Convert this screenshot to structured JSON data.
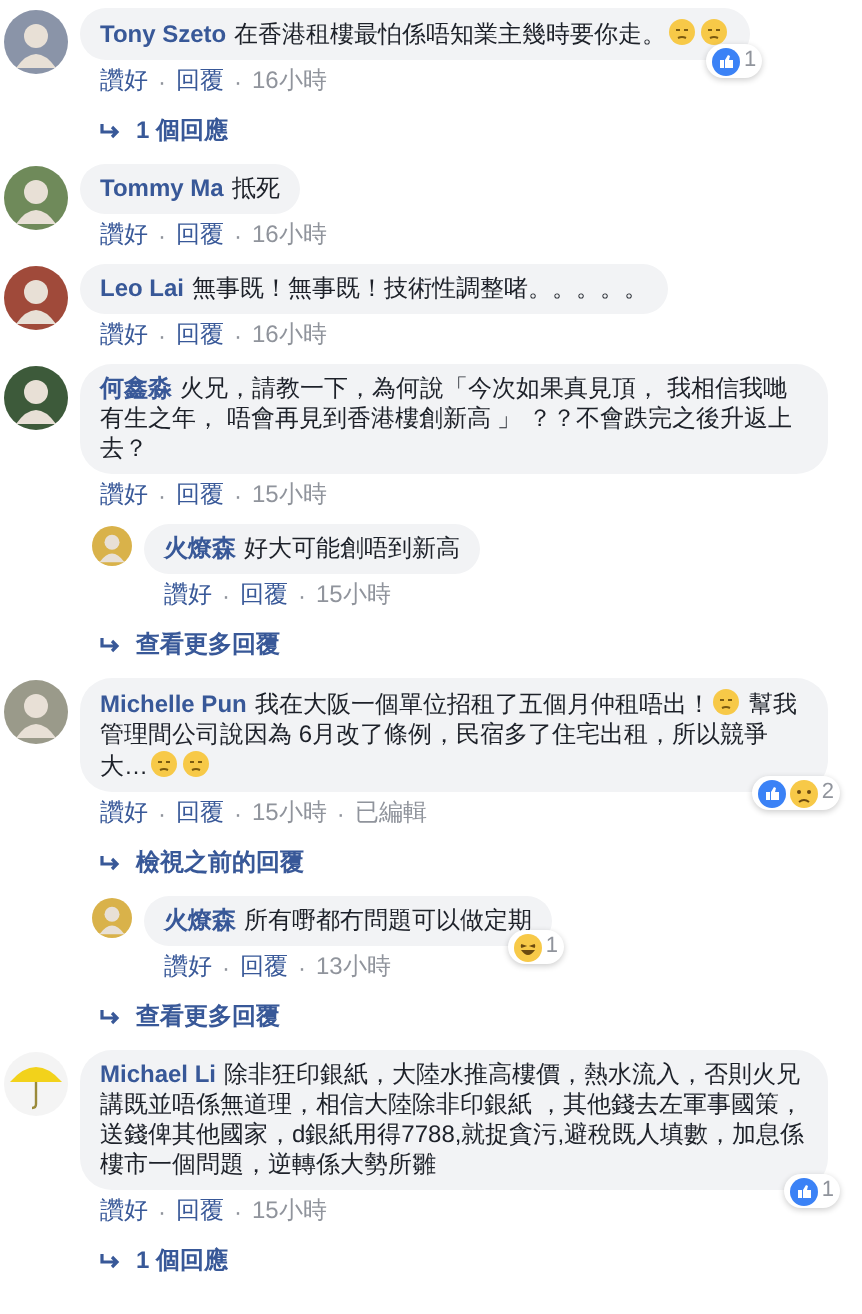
{
  "items": [
    {
      "kind": "comment",
      "avatar": {
        "kind": "person",
        "color": "#8a94a8"
      },
      "author": "Tony Szeto",
      "parts": [
        {
          "kind": "text",
          "text": "在香港租樓最怕係唔知業主幾時要你走。"
        },
        {
          "kind": "emoji"
        },
        {
          "kind": "emoji"
        }
      ],
      "meta": [
        {
          "kind": "link",
          "text": "讚好"
        },
        {
          "kind": "sep",
          "text": "·"
        },
        {
          "kind": "link",
          "text": "回覆"
        },
        {
          "kind": "sep",
          "text": "·"
        },
        {
          "kind": "time",
          "text": "16小時"
        }
      ],
      "reactions": {
        "icons": [
          {
            "kind": "like"
          }
        ],
        "count": "1"
      }
    },
    {
      "kind": "more",
      "text": "1 個回應"
    },
    {
      "kind": "comment",
      "avatar": {
        "kind": "person",
        "color": "#6f8a5a"
      },
      "author": "Tommy Ma",
      "parts": [
        {
          "kind": "text",
          "text": "抵死"
        }
      ],
      "meta": [
        {
          "kind": "link",
          "text": "讚好"
        },
        {
          "kind": "sep",
          "text": "·"
        },
        {
          "kind": "link",
          "text": "回覆"
        },
        {
          "kind": "sep",
          "text": "·"
        },
        {
          "kind": "time",
          "text": "16小時"
        }
      ]
    },
    {
      "kind": "comment",
      "avatar": {
        "kind": "person",
        "color": "#a04a3a"
      },
      "author": "Leo Lai",
      "parts": [
        {
          "kind": "text",
          "text": "無事既！無事既！技術性調整啫。。。。。"
        }
      ],
      "meta": [
        {
          "kind": "link",
          "text": "讚好"
        },
        {
          "kind": "sep",
          "text": "·"
        },
        {
          "kind": "link",
          "text": "回覆"
        },
        {
          "kind": "sep",
          "text": "·"
        },
        {
          "kind": "time",
          "text": "16小時"
        }
      ]
    },
    {
      "kind": "comment",
      "avatar": {
        "kind": "person",
        "color": "#3d5a3a"
      },
      "author": "何鑫淼",
      "parts": [
        {
          "kind": "text",
          "text": "火兄，請教一下，為何說「今次如果真見頂， 我相信我哋有生之年， 唔會再見到香港樓創新高 」 ？？不會跌完之後升返上去？"
        }
      ],
      "meta": [
        {
          "kind": "link",
          "text": "讚好"
        },
        {
          "kind": "sep",
          "text": "·"
        },
        {
          "kind": "link",
          "text": "回覆"
        },
        {
          "kind": "sep",
          "text": "·"
        },
        {
          "kind": "time",
          "text": "15小時"
        }
      ]
    },
    {
      "kind": "reply",
      "avatar": {
        "kind": "person",
        "color": "#d9b24a"
      },
      "author": "火燎森",
      "parts": [
        {
          "kind": "text",
          "text": "好大可能創唔到新高"
        }
      ],
      "meta": [
        {
          "kind": "link",
          "text": "讚好"
        },
        {
          "kind": "sep",
          "text": "·"
        },
        {
          "kind": "link",
          "text": "回覆"
        },
        {
          "kind": "sep",
          "text": "·"
        },
        {
          "kind": "time",
          "text": "15小時"
        }
      ]
    },
    {
      "kind": "more",
      "text": "查看更多回覆"
    },
    {
      "kind": "comment",
      "avatar": {
        "kind": "person",
        "color": "#9a9a8a"
      },
      "author": "Michelle Pun",
      "parts": [
        {
          "kind": "text",
          "text": "我在大阪一個單位招租了五個月仲租唔出！"
        },
        {
          "kind": "emoji"
        },
        {
          "kind": "text",
          "text": " 幫我管理間公司說因為 6月改了條例，民宿多了住宅出租，所以競爭大…"
        },
        {
          "kind": "emoji"
        },
        {
          "kind": "emoji"
        }
      ],
      "meta": [
        {
          "kind": "link",
          "text": "讚好"
        },
        {
          "kind": "sep",
          "text": "·"
        },
        {
          "kind": "link",
          "text": "回覆"
        },
        {
          "kind": "sep",
          "text": "·"
        },
        {
          "kind": "time",
          "text": "15小時"
        },
        {
          "kind": "sep",
          "text": "·"
        },
        {
          "kind": "edited",
          "text": "已編輯"
        }
      ],
      "reactions": {
        "icons": [
          {
            "kind": "like"
          },
          {
            "kind": "sad"
          }
        ],
        "count": "2"
      }
    },
    {
      "kind": "more",
      "text": "檢視之前的回覆"
    },
    {
      "kind": "reply",
      "avatar": {
        "kind": "person",
        "color": "#d9b24a"
      },
      "author": "火燎森",
      "parts": [
        {
          "kind": "text",
          "text": "所有嘢都冇問題可以做定期"
        }
      ],
      "meta": [
        {
          "kind": "link",
          "text": "讚好"
        },
        {
          "kind": "sep",
          "text": "·"
        },
        {
          "kind": "link",
          "text": "回覆"
        },
        {
          "kind": "sep",
          "text": "·"
        },
        {
          "kind": "time",
          "text": "13小時"
        }
      ],
      "reactions": {
        "icons": [
          {
            "kind": "haha"
          }
        ],
        "count": "1"
      }
    },
    {
      "kind": "more",
      "text": "查看更多回覆"
    },
    {
      "kind": "comment",
      "avatar": {
        "kind": "umbrella",
        "color": "#f2d21b"
      },
      "author": "Michael Li",
      "parts": [
        {
          "kind": "text",
          "text": "除非狂印銀紙，大陸水推高樓價，熱水流入，否則火兄講既並唔係無道理，相信大陸除非印銀紙 ，其他錢去左軍事國策，送錢俾其他國家，d銀紙用得7788,就捉貪污,避稅既人填數，加息係樓市一個問題，逆轉係大勢所雛"
        }
      ],
      "meta": [
        {
          "kind": "link",
          "text": "讚好"
        },
        {
          "kind": "sep",
          "text": "·"
        },
        {
          "kind": "link",
          "text": "回覆"
        },
        {
          "kind": "sep",
          "text": "·"
        },
        {
          "kind": "time",
          "text": "15小時"
        }
      ],
      "reactions": {
        "icons": [
          {
            "kind": "like"
          }
        ],
        "count": "1"
      }
    },
    {
      "kind": "more",
      "text": "1 個回應"
    }
  ]
}
